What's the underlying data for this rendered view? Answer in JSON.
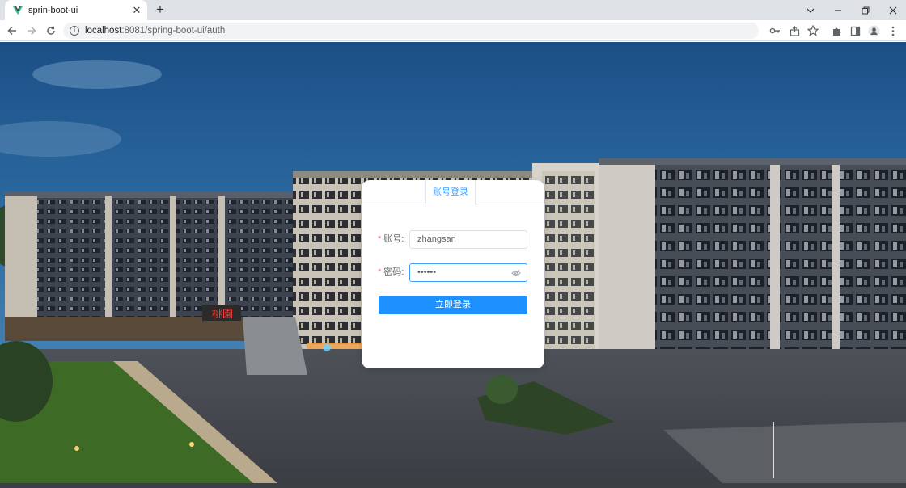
{
  "browser": {
    "tab_title": "sprin-boot-ui",
    "new_tab": "+",
    "url_host": "localhost",
    "url_rest": ":8081/spring-boot-ui/auth",
    "window_controls": [
      "chevron-down-icon",
      "minimize-icon",
      "restore-icon",
      "close-icon"
    ]
  },
  "login": {
    "tab_label": "账号登录",
    "username_label": "账号:",
    "username_value": "zhangsan",
    "password_label": "密码:",
    "password_value": "••••••",
    "required_mark": "*",
    "submit_label": "立即登录"
  },
  "colors": {
    "accent": "#409eff",
    "button": "#1e90ff",
    "required": "#f56c6c"
  }
}
